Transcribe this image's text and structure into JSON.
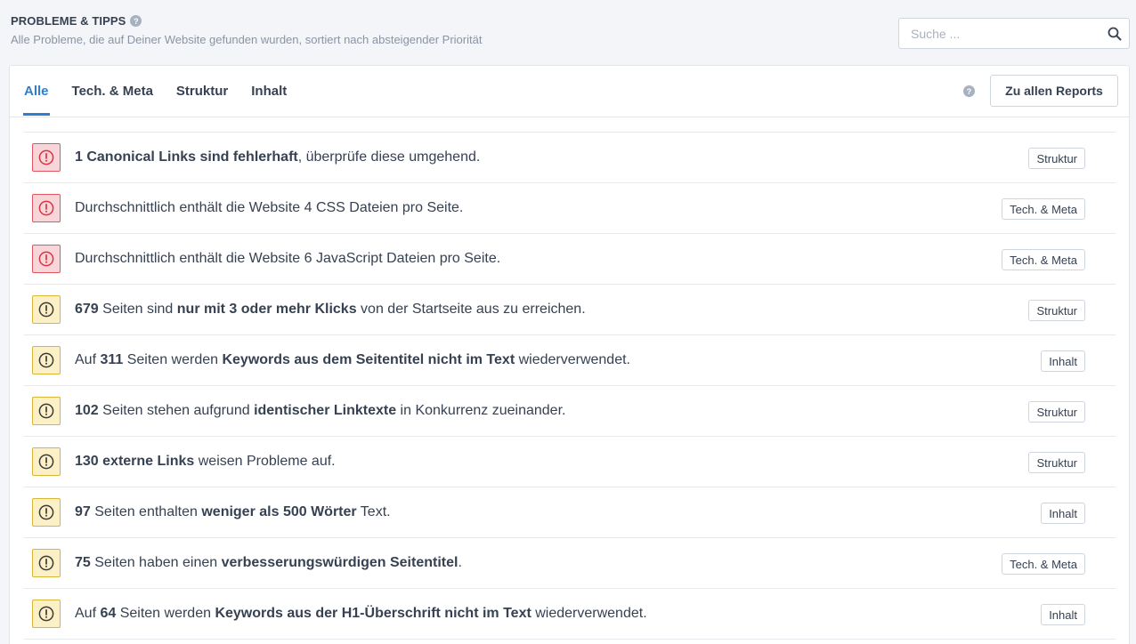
{
  "header": {
    "title": "PROBLEME & TIPPS",
    "subtitle": "Alle Probleme, die auf Deiner Website gefunden wurden, sortiert nach absteigender Priorität",
    "help_icon": "question-circle-icon"
  },
  "search": {
    "placeholder": "Suche ...",
    "value": "",
    "icon": "search-icon"
  },
  "tabs": [
    {
      "label": "Alle",
      "active": true
    },
    {
      "label": "Tech. & Meta",
      "active": false
    },
    {
      "label": "Struktur",
      "active": false
    },
    {
      "label": "Inhalt",
      "active": false
    }
  ],
  "reports_button": "Zu allen Reports",
  "colors": {
    "accent": "#2f7dd1",
    "error_bg": "#f8d5d8",
    "error_border": "#e0555f",
    "error_icon": "#d93442",
    "warn_bg": "#fbf0c6",
    "warn_border": "#d9b637",
    "warn_icon": "#3a3a3a"
  },
  "issues": [
    {
      "severity": "error",
      "parts": [
        {
          "t": "1 Canonical Links sind fehlerhaft",
          "b": true
        },
        {
          "t": ", überprüfe diese umgehend.",
          "b": false
        }
      ],
      "category": "Struktur"
    },
    {
      "severity": "error",
      "parts": [
        {
          "t": "Durchschnittlich enthält die Website 4 CSS Dateien pro Seite.",
          "b": false
        }
      ],
      "category": "Tech. & Meta"
    },
    {
      "severity": "error",
      "parts": [
        {
          "t": "Durchschnittlich enthält die Website 6 JavaScript Dateien pro Seite.",
          "b": false
        }
      ],
      "category": "Tech. & Meta"
    },
    {
      "severity": "warn",
      "parts": [
        {
          "t": "679",
          "b": true
        },
        {
          "t": " Seiten sind ",
          "b": false
        },
        {
          "t": "nur mit 3 oder mehr Klicks",
          "b": true
        },
        {
          "t": " von der Startseite aus zu erreichen.",
          "b": false
        }
      ],
      "category": "Struktur"
    },
    {
      "severity": "warn",
      "parts": [
        {
          "t": "Auf ",
          "b": false
        },
        {
          "t": "311",
          "b": true
        },
        {
          "t": " Seiten werden ",
          "b": false
        },
        {
          "t": "Keywords aus dem Seitentitel nicht im Text",
          "b": true
        },
        {
          "t": " wiederverwendet.",
          "b": false
        }
      ],
      "category": "Inhalt"
    },
    {
      "severity": "warn",
      "parts": [
        {
          "t": "102",
          "b": true
        },
        {
          "t": " Seiten stehen aufgrund ",
          "b": false
        },
        {
          "t": "identischer Linktexte",
          "b": true
        },
        {
          "t": " in Konkurrenz zueinander.",
          "b": false
        }
      ],
      "category": "Struktur"
    },
    {
      "severity": "warn",
      "parts": [
        {
          "t": "130 externe Links",
          "b": true
        },
        {
          "t": " weisen Probleme auf.",
          "b": false
        }
      ],
      "category": "Struktur"
    },
    {
      "severity": "warn",
      "parts": [
        {
          "t": "97",
          "b": true
        },
        {
          "t": " Seiten enthalten ",
          "b": false
        },
        {
          "t": "weniger als 500 Wörter",
          "b": true
        },
        {
          "t": " Text.",
          "b": false
        }
      ],
      "category": "Inhalt"
    },
    {
      "severity": "warn",
      "parts": [
        {
          "t": "75",
          "b": true
        },
        {
          "t": " Seiten haben einen ",
          "b": false
        },
        {
          "t": "verbesserungswürdigen Seitentitel",
          "b": true
        },
        {
          "t": ".",
          "b": false
        }
      ],
      "category": "Tech. & Meta"
    },
    {
      "severity": "warn",
      "parts": [
        {
          "t": "Auf ",
          "b": false
        },
        {
          "t": "64",
          "b": true
        },
        {
          "t": " Seiten werden ",
          "b": false
        },
        {
          "t": "Keywords aus der H1-Überschrift nicht im Text",
          "b": true
        },
        {
          "t": " wiederverwendet.",
          "b": false
        }
      ],
      "category": "Inhalt"
    }
  ]
}
